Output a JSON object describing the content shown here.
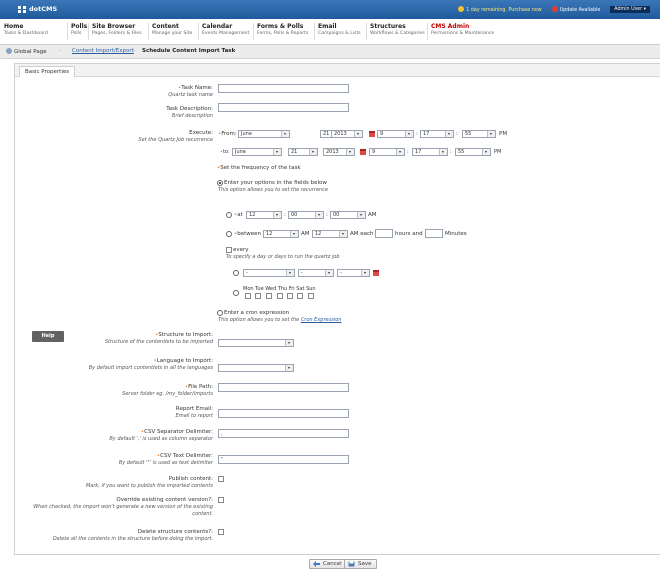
{
  "app": {
    "logo": "dotCMS"
  },
  "topbar": {
    "license_notice": "1 day remaining. Purchase now",
    "update_text": "Update Available",
    "user_menu": "Admin User"
  },
  "menu": [
    {
      "title": "Home",
      "subtitle": "Tasks & Dashboard"
    },
    {
      "title": "Polls",
      "subtitle": "Polls"
    },
    {
      "title": "Site Browser",
      "subtitle": "Pages, Folders & Files"
    },
    {
      "title": "Content",
      "subtitle": "Manage your Site"
    },
    {
      "title": "Calendar",
      "subtitle": "Events Management"
    },
    {
      "title": "Forms & Polls",
      "subtitle": "Forms, Polls & Reports"
    },
    {
      "title": "Email",
      "subtitle": "Campaigns & Lists"
    },
    {
      "title": "Structures",
      "subtitle": "Workflows & Categories"
    },
    {
      "title": "CMS Admin",
      "subtitle": "Permissions & Maintenance"
    }
  ],
  "breadcrumb": {
    "home": "Global Page",
    "section": "Content Import/Export",
    "current": "Schedule Content Import Task"
  },
  "tabs": {
    "basic": "Basic Properties"
  },
  "form": {
    "task_name": {
      "label": "Task Name:",
      "hint": "Quartz task name",
      "value": ""
    },
    "task_description": {
      "label": "Task Description:",
      "hint": "Brief description",
      "value": ""
    },
    "execute": {
      "label": "Execute:",
      "hint": "Set the Quartz Job recurrence"
    },
    "from": {
      "label": "From:",
      "month": "June",
      "day": "21",
      "year": "2013",
      "hour": "9",
      "minute": "17",
      "second": "55",
      "ampm": "PM"
    },
    "to": {
      "label": "to:",
      "month": "June",
      "day": "21",
      "year": "2013",
      "hour": "9",
      "minute": "17",
      "second": "55",
      "ampm": "PM"
    },
    "frequency_title": "Set the frequency of the task",
    "option_fields": {
      "label": "Enter your options in the fields below",
      "hint": "This option allows you to set the recurrence"
    },
    "at": {
      "label": "at",
      "hour": "12",
      "minute": "00",
      "second": "00",
      "ampm": "AM",
      "colon": ":"
    },
    "between": {
      "label": "between",
      "from_hour": "12",
      "from_ampm": "AM",
      "to_hour": "12",
      "to_ampm": "AM each",
      "hours_label": "hours and",
      "minutes_label": "Minutes"
    },
    "every": {
      "label": "every",
      "hint": "To specify a day or days to run the quartz job"
    },
    "dash": "-",
    "weekdays": "Mon Tue Wed Thu Fri Sat Sun",
    "cron": {
      "label": "Enter a cron expression",
      "hint_prefix": "This option allows you to set the",
      "hint_link": "Cron Expression"
    },
    "help_button": "Help",
    "structure": {
      "label": "Structure to Import:",
      "hint": "Structure of the contentlets to be imported"
    },
    "language": {
      "label": "Language to Import:",
      "hint": "By default import contentlets in all the languages"
    },
    "file_path": {
      "label": "File Path:",
      "hint": "Server folder eg. /my_folder/imports",
      "value": ""
    },
    "report_email": {
      "label": "Report Email:",
      "hint": "Email to report",
      "value": ""
    },
    "csv_separator": {
      "label": "CSV Separator Delimiter:",
      "hint": "By default ',' is used as column separator",
      "value": ","
    },
    "csv_text": {
      "label": "CSV Text Delimiter:",
      "hint": "By default '\"' is used as text delimiter",
      "value": "\""
    },
    "publish": {
      "label": "Publish content:",
      "hint": "Mark, if you want to publish the imported contents"
    },
    "override": {
      "label": "Override existing content version?:",
      "hint1": "When checked, the import won't generate a new version of the existing",
      "hint2": "content."
    },
    "delete": {
      "label": "Delete structure contents?:",
      "hint": "Delete all the contents in the structure before doing the import."
    }
  },
  "actions": {
    "cancel": "Cancel",
    "save": "Save"
  },
  "colors": {
    "topbar": "#1f5a9c",
    "required": "#e6820f",
    "active_menu": "#c40000",
    "link": "#2a5d9f"
  }
}
